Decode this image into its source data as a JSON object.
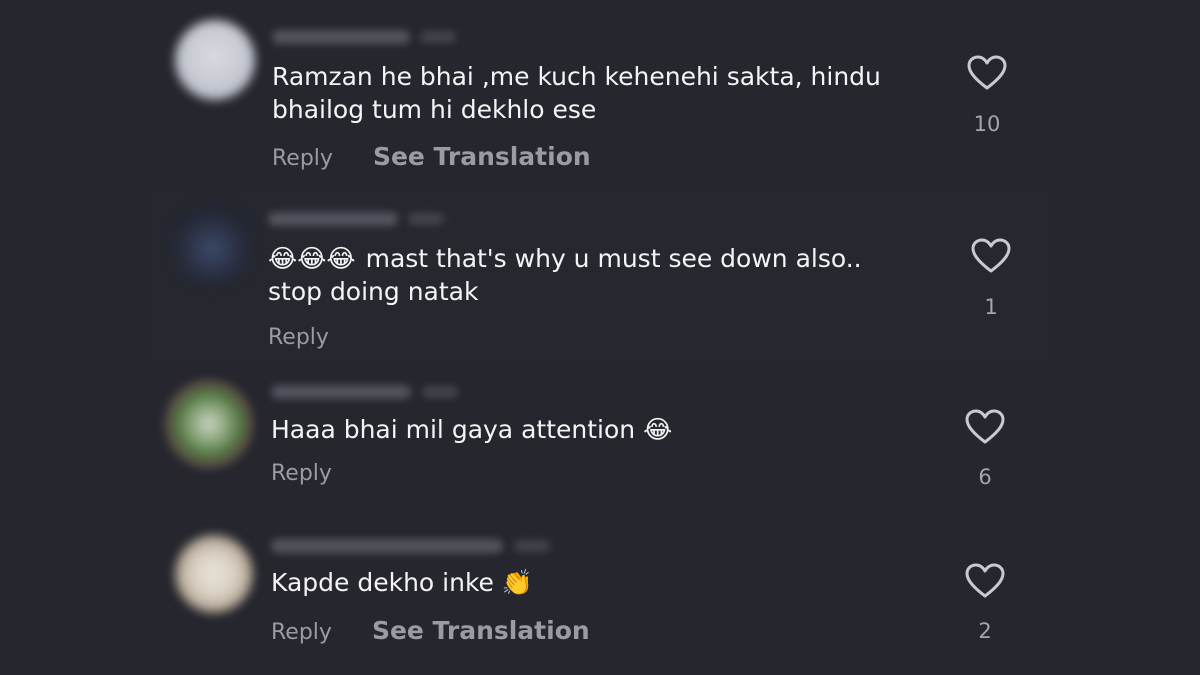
{
  "comments": [
    {
      "text_lines": [
        "Ramzan he bhai ,me kuch kehenehi sakta, hindu",
        "bhailog tum hi dekhlo ese"
      ],
      "reply_label": "Reply",
      "translate_label": "See Translation",
      "likes": "10"
    },
    {
      "emoji": "😂😂😂",
      "text_lines": [
        "mast that's why u must see down also..",
        "stop doing natak"
      ],
      "reply_label": "Reply",
      "likes": "1"
    },
    {
      "text_lines": [
        "Haaa bhai mil gaya attention"
      ],
      "emoji": "😂",
      "reply_label": "Reply",
      "likes": "6"
    },
    {
      "text_lines": [
        "Kapde dekho inke"
      ],
      "emoji": "👏",
      "reply_label": "Reply",
      "translate_label": "See Translation",
      "likes": "2"
    }
  ],
  "icons": {
    "like": "heart-outline-icon"
  }
}
